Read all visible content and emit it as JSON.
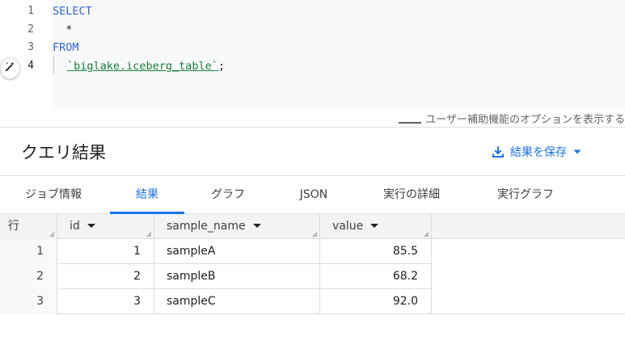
{
  "editor": {
    "line_numbers": [
      "1",
      "2",
      "3",
      "4"
    ],
    "lines": {
      "l1": "SELECT",
      "l2": "  *",
      "l3": "FROM",
      "l4_table": "`biglake.iceberg_table`",
      "l4_end": ";"
    },
    "accessibility_hint": "ユーザー補助機能のオプションを表示する"
  },
  "results": {
    "title": "クエリ結果",
    "save_label": "結果を保存"
  },
  "tabs": [
    "ジョブ情報",
    "結果",
    "グラフ",
    "JSON",
    "実行の詳細",
    "実行グラフ"
  ],
  "active_tab": "結果",
  "table": {
    "row_header": "行",
    "columns": [
      "id",
      "sample_name",
      "value"
    ],
    "rows": [
      {
        "row": "1",
        "id": "1",
        "sample_name": "sampleA",
        "value": "85.5"
      },
      {
        "row": "2",
        "id": "2",
        "sample_name": "sampleB",
        "value": "68.2"
      },
      {
        "row": "3",
        "id": "3",
        "sample_name": "sampleC",
        "value": "92.0"
      }
    ]
  },
  "colors": {
    "accent": "#1a73e8",
    "keyword": "#3367d6",
    "table_name": "#188038"
  },
  "icons": {
    "ai_assist": "magic-pen-icon",
    "save": "download-icon",
    "dropdown": "caret-down-icon"
  }
}
